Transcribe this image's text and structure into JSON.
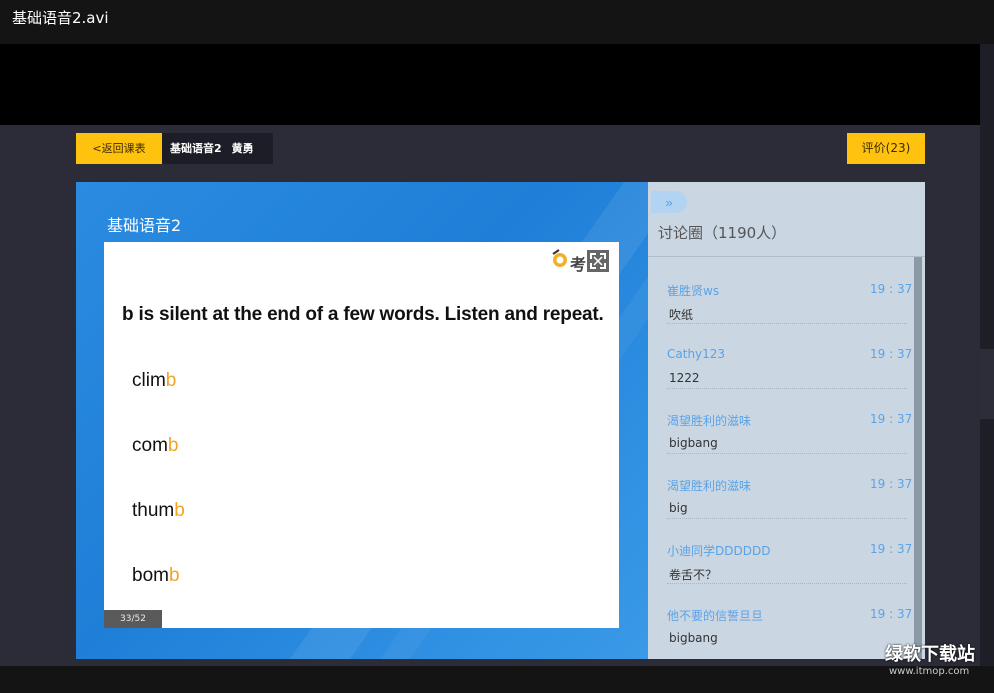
{
  "window": {
    "title": "基础语音2.avi"
  },
  "topbar": {
    "back_label": "<返回课表",
    "course_name": "基础语音2",
    "teacher": "黄勇",
    "rate_label": "评价(23)"
  },
  "stage": {
    "title": "基础语音2",
    "slide": {
      "logo_text": "考",
      "heading": "b is silent at the end of a few words. Listen and repeat.",
      "words": [
        {
          "stem": "clim",
          "silent": "b"
        },
        {
          "stem": "com",
          "silent": "b"
        },
        {
          "stem": "thum",
          "silent": "b"
        },
        {
          "stem": "bom",
          "silent": "b"
        }
      ],
      "page_indicator": "33/52"
    }
  },
  "discussion": {
    "collapse_label": "»",
    "title": "讨论圈（1190人）",
    "messages": [
      {
        "user": "崔胜贤ws",
        "time": "19 : 37",
        "text": "吹纸"
      },
      {
        "user": "Cathy123",
        "time": "19 : 37",
        "text": "1222"
      },
      {
        "user": "渴望胜利的滋味",
        "time": "19 : 37",
        "text": "bigbang"
      },
      {
        "user": "渴望胜利的滋味",
        "time": "19 : 37",
        "text": "big"
      },
      {
        "user": "小迪同学DDDDDD",
        "time": "19 : 37",
        "text": "卷舌不？"
      },
      {
        "user": "他不要的信誓旦旦",
        "time": "19 : 37",
        "text": "bigbang"
      }
    ]
  },
  "watermark": {
    "name": "绿软下载站",
    "url": "www.itmop.com"
  },
  "colors": {
    "accent": "#ffc20e",
    "highlight": "#f0a624",
    "link": "#5aa3e6",
    "stage": "#2a8be0"
  },
  "icons": {
    "fullscreen": "fullscreen-icon",
    "logo": "logo-icon"
  }
}
